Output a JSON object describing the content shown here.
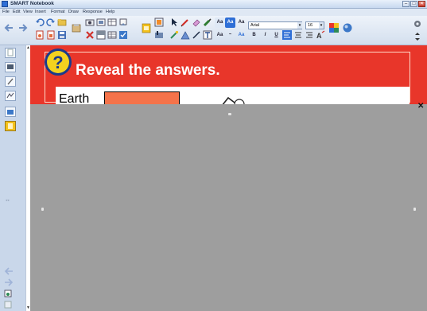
{
  "window": {
    "title": "SMART Notebook",
    "min": "–",
    "max": "□",
    "close": "✕"
  },
  "menu": [
    "File",
    "Edit",
    "View",
    "Insert",
    "Format",
    "Draw",
    "Response",
    "Help"
  ],
  "toolbar": {
    "font_name": "Arial",
    "font_size": "16",
    "text_buttons": {
      "bold": "B",
      "italic": "I",
      "underline": "U",
      "a1": "Aa",
      "a2": "Aa",
      "a3": "Aa",
      "a4": "Aa"
    }
  },
  "lesson": {
    "title": "Reveal the answers.",
    "question_icon": "?",
    "word": "Earth"
  },
  "colors": {
    "lesson_red": "#e8362a",
    "answer_orange": "#f4734a",
    "shade_gray": "#9e9e9e",
    "question_yellow": "#f3d21f"
  },
  "shade": {
    "close": "✕"
  }
}
